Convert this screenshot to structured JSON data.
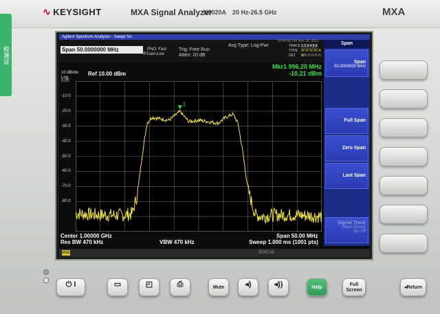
{
  "header": {
    "logo_text": "KEYSIGHT",
    "model_title": "MXA Signal Analyzer",
    "model_number": "N9020A",
    "freq_range": "20 Hz-26.5 GHz",
    "brand": "MXA"
  },
  "sticker_text": "校准证",
  "screen": {
    "window_title": "Agilent Spectrum Analyzer - Swept SA",
    "span_field": "Span 50.0000000 MHz",
    "pno": "PNO: Fast",
    "ifgain": "IFGain:Low",
    "trig": "Trig: Free Run",
    "atten": "Atten: 20 dB",
    "avg_type": "Avg Type: Log-Pwr",
    "timestamp": "02:45:42 PM Nov 29, 2021",
    "trace_label": "TRACE",
    "trace_nums": "1 2 3 4 5 6",
    "type_label": "TYPE",
    "type_vals": "W W W W W W",
    "det_label": "DET",
    "det_vals": "N N N N N N",
    "marker_label": "Mkr1 996.20 MHz",
    "marker_value": "-10.21 dBm",
    "scale_div": "10 dB/div",
    "scale_type": "Log",
    "ref_level": "Ref 10.00 dBm",
    "marker_tag": "1",
    "center": "Center 1.00000 GHz",
    "res_bw": "Res BW 470 kHz",
    "vbw": "VBW 470 kHz",
    "span_bottom": "Span 50.00 MHz",
    "sweep": "Sweep  1.000 ms (1001 pts)",
    "status_msg": "MSG",
    "status_label": "STATUS"
  },
  "softkeys": {
    "menu_title": "Span",
    "items": [
      {
        "label": "Span",
        "sub": "50.0000000 MHz"
      },
      {
        "label": "Full Span",
        "sub": ""
      },
      {
        "label": "Zero Span",
        "sub": ""
      },
      {
        "label": "Last Span",
        "sub": ""
      },
      {
        "label": "Signal Track",
        "sub": "(Span Zoom)",
        "state": "On  Off"
      }
    ]
  },
  "front_panel": {
    "power": "⏻ I",
    "mute": "Mute",
    "help": "Help",
    "full_screen_1": "Full",
    "full_screen_2": "Screen",
    "return": "Return"
  },
  "chart_data": {
    "type": "line",
    "title": "",
    "xlabel": "",
    "ylabel": "",
    "y_ticks": [
      "0.00",
      "-10.0",
      "-20.0",
      "-30.0",
      "-40.0",
      "-50.0",
      "-60.0",
      "-70.0",
      "-80.0"
    ],
    "ylim": [
      -90,
      10
    ],
    "xlim_mhz": [
      975,
      1025
    ],
    "grid": true,
    "series": [
      {
        "x": [
          975,
          980,
          985,
          986.5,
          987.5,
          988.5,
          989.5,
          990.5,
          992,
          994,
          996.2,
          998,
          1000,
          1002,
          1004,
          1005.5,
          1007,
          1008,
          1009,
          1010,
          1011.5,
          1013,
          1015,
          1020,
          1025
        ],
        "y": [
          -78,
          -79,
          -79,
          -78,
          -66,
          -40,
          -18,
          -14,
          -15,
          -16,
          -10.2,
          -17,
          -16,
          -17,
          -18,
          -14,
          -12,
          -18,
          -38,
          -62,
          -79,
          -80,
          -79,
          -79,
          -80
        ]
      }
    ],
    "marker": {
      "x": 996.2,
      "y": -10.21,
      "label": "1"
    }
  }
}
